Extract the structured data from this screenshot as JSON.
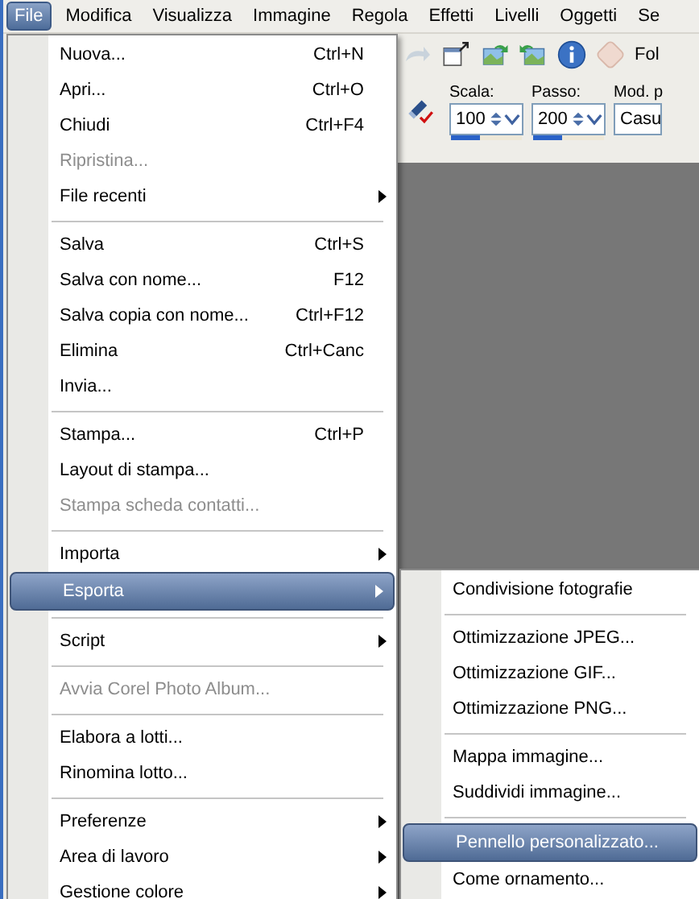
{
  "menu_bar": [
    {
      "label": "File",
      "selected": true
    },
    {
      "label": "Modifica",
      "selected": false
    },
    {
      "label": "Visualizza",
      "selected": false
    },
    {
      "label": "Immagine",
      "selected": false
    },
    {
      "label": "Regola",
      "selected": false
    },
    {
      "label": "Effetti",
      "selected": false
    },
    {
      "label": "Livelli",
      "selected": false
    },
    {
      "label": "Oggetti",
      "selected": false
    },
    {
      "label": "Se",
      "selected": false
    }
  ],
  "toolbar": {
    "button_label": "Fol",
    "fields": [
      {
        "label": "Scala:",
        "value": "100",
        "level": 0.4
      },
      {
        "label": "Passo:",
        "value": "200",
        "level": 0.4
      }
    ],
    "mode": {
      "label": "Mod. p",
      "value": "Casu"
    }
  },
  "file_menu": [
    {
      "kind": "item",
      "label": "Nuova...",
      "shortcut": "Ctrl+N",
      "disabled": false,
      "submenu": false,
      "selected": false
    },
    {
      "kind": "item",
      "label": "Apri...",
      "shortcut": "Ctrl+O",
      "disabled": false,
      "submenu": false,
      "selected": false
    },
    {
      "kind": "item",
      "label": "Chiudi",
      "shortcut": "Ctrl+F4",
      "disabled": false,
      "submenu": false,
      "selected": false
    },
    {
      "kind": "item",
      "label": "Ripristina...",
      "disabled": true,
      "submenu": false,
      "selected": false
    },
    {
      "kind": "item",
      "label": "File recenti",
      "disabled": false,
      "submenu": true,
      "selected": false
    },
    {
      "kind": "separator"
    },
    {
      "kind": "item",
      "label": "Salva",
      "shortcut": "Ctrl+S",
      "disabled": false,
      "submenu": false,
      "selected": false
    },
    {
      "kind": "item",
      "label": "Salva con nome...",
      "shortcut": "F12",
      "disabled": false,
      "submenu": false,
      "selected": false
    },
    {
      "kind": "item",
      "label": "Salva copia con nome...",
      "shortcut": "Ctrl+F12",
      "disabled": false,
      "submenu": false,
      "selected": false
    },
    {
      "kind": "item",
      "label": "Elimina",
      "shortcut": "Ctrl+Canc",
      "disabled": false,
      "submenu": false,
      "selected": false
    },
    {
      "kind": "item",
      "label": "Invia...",
      "disabled": false,
      "submenu": false,
      "selected": false
    },
    {
      "kind": "separator"
    },
    {
      "kind": "item",
      "label": "Stampa...",
      "shortcut": "Ctrl+P",
      "disabled": false,
      "submenu": false,
      "selected": false
    },
    {
      "kind": "item",
      "label": "Layout di stampa...",
      "disabled": false,
      "submenu": false,
      "selected": false
    },
    {
      "kind": "item",
      "label": "Stampa scheda contatti...",
      "disabled": true,
      "submenu": false,
      "selected": false
    },
    {
      "kind": "separator"
    },
    {
      "kind": "item",
      "label": "Importa",
      "disabled": false,
      "submenu": true,
      "selected": false
    },
    {
      "kind": "item",
      "label": "Esporta",
      "disabled": false,
      "submenu": true,
      "selected": true
    },
    {
      "kind": "separator"
    },
    {
      "kind": "item",
      "label": "Script",
      "disabled": false,
      "submenu": true,
      "selected": false
    },
    {
      "kind": "separator"
    },
    {
      "kind": "item",
      "label": "Avvia Corel Photo Album...",
      "disabled": true,
      "submenu": false,
      "selected": false
    },
    {
      "kind": "separator"
    },
    {
      "kind": "item",
      "label": "Elabora a lotti...",
      "disabled": false,
      "submenu": false,
      "selected": false
    },
    {
      "kind": "item",
      "label": "Rinomina lotto...",
      "disabled": false,
      "submenu": false,
      "selected": false
    },
    {
      "kind": "separator"
    },
    {
      "kind": "item",
      "label": "Preferenze",
      "disabled": false,
      "submenu": true,
      "selected": false
    },
    {
      "kind": "item",
      "label": "Area di lavoro",
      "disabled": false,
      "submenu": true,
      "selected": false
    },
    {
      "kind": "item",
      "label": "Gestione colore",
      "disabled": false,
      "submenu": true,
      "selected": false
    }
  ],
  "export_submenu": [
    {
      "kind": "item",
      "label": "Condivisione fotografie",
      "selected": false
    },
    {
      "kind": "separator"
    },
    {
      "kind": "item",
      "label": "Ottimizzazione JPEG...",
      "selected": false
    },
    {
      "kind": "item",
      "label": "Ottimizzazione GIF...",
      "selected": false
    },
    {
      "kind": "item",
      "label": "Ottimizzazione PNG...",
      "selected": false
    },
    {
      "kind": "separator"
    },
    {
      "kind": "item",
      "label": "Mappa immagine...",
      "selected": false
    },
    {
      "kind": "item",
      "label": "Suddividi immagine...",
      "selected": false
    },
    {
      "kind": "separator"
    },
    {
      "kind": "item",
      "label": "Pennello personalizzato...",
      "selected": true
    },
    {
      "kind": "item",
      "label": "Come ornamento...",
      "selected": false
    }
  ]
}
